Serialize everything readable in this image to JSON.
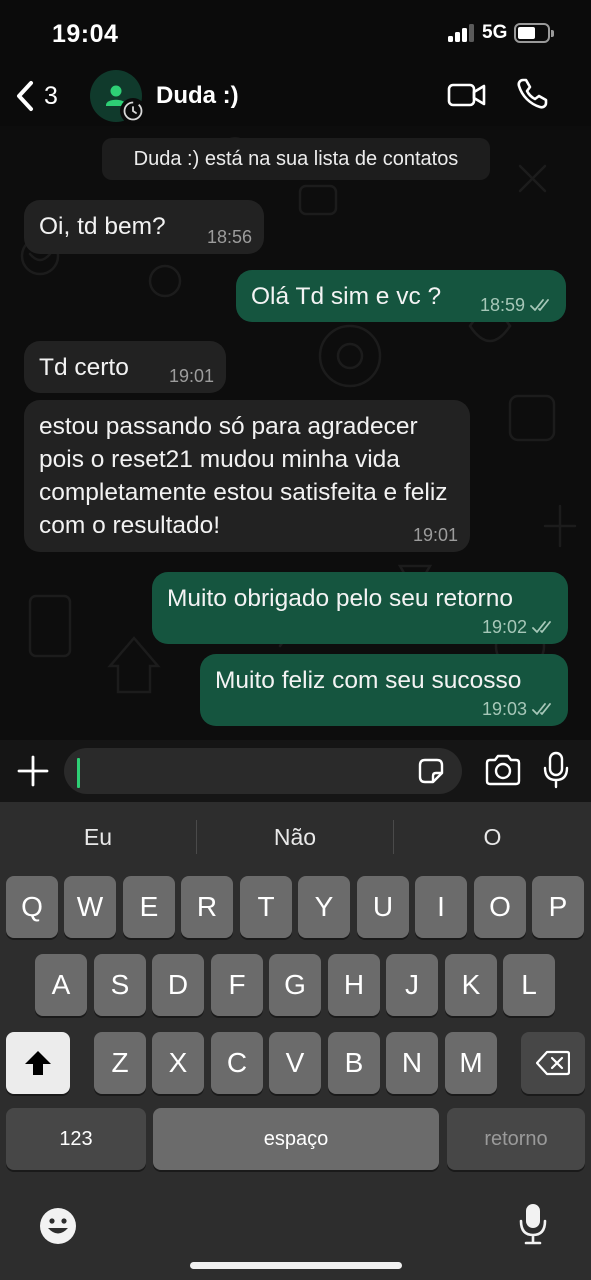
{
  "status_bar": {
    "time": "19:04",
    "network": "5G"
  },
  "header": {
    "back_count": "3",
    "contact_name": "Duda :)"
  },
  "system_notice": "Duda :) está na sua lista de contatos",
  "messages": [
    {
      "dir": "in",
      "text": "Oi, td bem?",
      "time": "18:56"
    },
    {
      "dir": "out",
      "text": "Olá Td sim e vc ?",
      "time": "18:59",
      "status": "read"
    },
    {
      "dir": "in",
      "text": "Td certo",
      "time": "19:01"
    },
    {
      "dir": "in",
      "text": "estou passando só para agradecer pois o reset21 mudou minha vida completamente estou satisfeita e feliz com o resultado!",
      "time": "19:01"
    },
    {
      "dir": "out",
      "text": "Muito obrigado pelo seu retorno",
      "time": "19:02",
      "status": "read"
    },
    {
      "dir": "out",
      "text": "Muito feliz com seu sucosso",
      "time": "19:03",
      "status": "read"
    }
  ],
  "composer": {
    "value": "",
    "placeholder": ""
  },
  "keyboard": {
    "suggestions": [
      "Eu",
      "Não",
      "O"
    ],
    "row1": [
      "Q",
      "W",
      "E",
      "R",
      "T",
      "Y",
      "U",
      "I",
      "O",
      "P"
    ],
    "row2": [
      "A",
      "S",
      "D",
      "F",
      "G",
      "H",
      "J",
      "K",
      "L"
    ],
    "row3": [
      "Z",
      "X",
      "C",
      "V",
      "B",
      "N",
      "M"
    ],
    "numbers_key": "123",
    "space_key": "espaço",
    "return_key": "retorno"
  },
  "colors": {
    "accent": "#2ecf75",
    "outgoing_bubble": "#15553f",
    "incoming_bubble": "#222222",
    "read_ticks": "#a6c7b8"
  },
  "icons": {
    "back": "chevron-left-icon",
    "avatar": "person-icon",
    "avatar_badge": "clock-icon",
    "video": "video-camera-icon",
    "phone": "phone-icon",
    "read_status": "double-check-icon",
    "plus": "plus-icon",
    "sticker": "sticker-icon",
    "camera": "camera-icon",
    "mic": "microphone-icon",
    "shift": "shift-arrow-icon",
    "backspace": "backspace-icon",
    "emoji": "emoji-icon",
    "dictation": "microphone-icon"
  }
}
